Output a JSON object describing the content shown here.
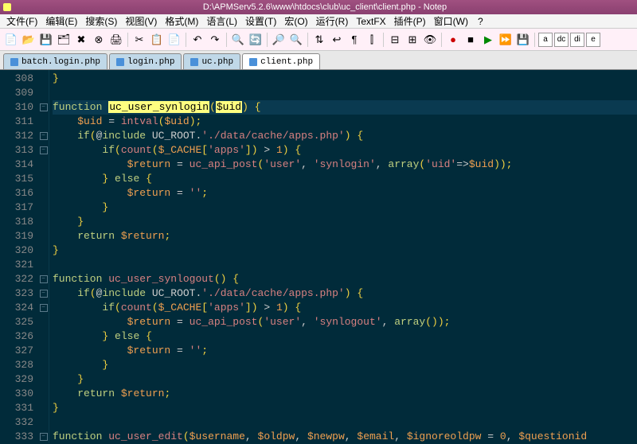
{
  "titlebar": {
    "title": "D:\\APMServ5.2.6\\www\\htdocs\\club\\uc_client\\client.php - Notep"
  },
  "menubar": {
    "items": [
      "文件(F)",
      "编辑(E)",
      "搜索(S)",
      "视图(V)",
      "格式(M)",
      "语言(L)",
      "设置(T)",
      "宏(O)",
      "运行(R)",
      "TextFX",
      "插件(P)",
      "窗口(W)",
      "?"
    ]
  },
  "toolbar": {
    "letters": [
      "a",
      "dc",
      "di",
      "e"
    ]
  },
  "tabs": {
    "items": [
      {
        "label": "batch.login.php",
        "active": false
      },
      {
        "label": "login.php",
        "active": false
      },
      {
        "label": "uc.php",
        "active": false
      },
      {
        "label": "client.php",
        "active": true
      }
    ]
  },
  "gutter": {
    "start": 308,
    "end": 333
  },
  "code": {
    "lines": [
      {
        "n": 308,
        "html": "<span class='pn'>}</span>"
      },
      {
        "n": 309,
        "html": ""
      },
      {
        "n": 310,
        "html": "<span class='kw'>function</span> <span class='fn-hl'>uc_user_synlogin</span><span class='pn'>(</span><span class='hl'>$uid</span><span class='pn'>)</span> <span class='pn'>{</span>",
        "cur": true,
        "fold": "-"
      },
      {
        "n": 311,
        "html": "    <span class='var'>$uid</span> <span class='op'>=</span> <span class='fn'>intval</span><span class='pn'>(</span><span class='var'>$uid</span><span class='pn'>);</span>"
      },
      {
        "n": 312,
        "html": "    <span class='kw'>if</span><span class='pn'>(</span><span class='op'>@</span><span class='kw'>include</span> <span class='const'>UC_ROOT</span><span class='op'>.</span><span class='str'>'./data/cache/apps.php'</span><span class='pn'>)</span> <span class='pn'>{</span>",
        "fold": "-"
      },
      {
        "n": 313,
        "html": "        <span class='kw'>if</span><span class='pn'>(</span><span class='fn'>count</span><span class='pn'>(</span><span class='var'>$_CACHE</span><span class='pn'>[</span><span class='str'>'apps'</span><span class='pn'>])</span> <span class='op'>&gt;</span> <span class='num'>1</span><span class='pn'>)</span> <span class='pn'>{</span>",
        "fold": "-"
      },
      {
        "n": 314,
        "html": "            <span class='var'>$return</span> <span class='op'>=</span> <span class='fn'>uc_api_post</span><span class='pn'>(</span><span class='str'>'user'</span><span class='op'>,</span> <span class='str'>'synlogin'</span><span class='op'>,</span> <span class='kw'>array</span><span class='pn'>(</span><span class='str'>'uid'</span><span class='op'>=&gt;</span><span class='var'>$uid</span><span class='pn'>));</span>"
      },
      {
        "n": 315,
        "html": "        <span class='pn'>}</span> <span class='kw'>else</span> <span class='pn'>{</span>"
      },
      {
        "n": 316,
        "html": "            <span class='var'>$return</span> <span class='op'>=</span> <span class='str'>''</span><span class='pn'>;</span>"
      },
      {
        "n": 317,
        "html": "        <span class='pn'>}</span>"
      },
      {
        "n": 318,
        "html": "    <span class='pn'>}</span>"
      },
      {
        "n": 319,
        "html": "    <span class='kw'>return</span> <span class='var'>$return</span><span class='pn'>;</span>"
      },
      {
        "n": 320,
        "html": "<span class='pn'>}</span>"
      },
      {
        "n": 321,
        "html": ""
      },
      {
        "n": 322,
        "html": "<span class='kw'>function</span> <span class='fn'>uc_user_synlogout</span><span class='pn'>()</span> <span class='pn'>{</span>",
        "fold": "-"
      },
      {
        "n": 323,
        "html": "    <span class='kw'>if</span><span class='pn'>(</span><span class='op'>@</span><span class='kw'>include</span> <span class='const'>UC_ROOT</span><span class='op'>.</span><span class='str'>'./data/cache/apps.php'</span><span class='pn'>)</span> <span class='pn'>{</span>",
        "fold": "-"
      },
      {
        "n": 324,
        "html": "        <span class='kw'>if</span><span class='pn'>(</span><span class='fn'>count</span><span class='pn'>(</span><span class='var'>$_CACHE</span><span class='pn'>[</span><span class='str'>'apps'</span><span class='pn'>])</span> <span class='op'>&gt;</span> <span class='num'>1</span><span class='pn'>)</span> <span class='pn'>{</span>",
        "fold": "-"
      },
      {
        "n": 325,
        "html": "            <span class='var'>$return</span> <span class='op'>=</span> <span class='fn'>uc_api_post</span><span class='pn'>(</span><span class='str'>'user'</span><span class='op'>,</span> <span class='str'>'synlogout'</span><span class='op'>,</span> <span class='kw'>array</span><span class='pn'>());</span>"
      },
      {
        "n": 326,
        "html": "        <span class='pn'>}</span> <span class='kw'>else</span> <span class='pn'>{</span>"
      },
      {
        "n": 327,
        "html": "            <span class='var'>$return</span> <span class='op'>=</span> <span class='str'>''</span><span class='pn'>;</span>"
      },
      {
        "n": 328,
        "html": "        <span class='pn'>}</span>"
      },
      {
        "n": 329,
        "html": "    <span class='pn'>}</span>"
      },
      {
        "n": 330,
        "html": "    <span class='kw'>return</span> <span class='var'>$return</span><span class='pn'>;</span>"
      },
      {
        "n": 331,
        "html": "<span class='pn'>}</span>"
      },
      {
        "n": 332,
        "html": ""
      },
      {
        "n": 333,
        "html": "<span class='kw'>function</span> <span class='fn'>uc_user_edit</span><span class='pn'>(</span><span class='var'>$username</span><span class='op'>,</span> <span class='var'>$oldpw</span><span class='op'>,</span> <span class='var'>$newpw</span><span class='op'>,</span> <span class='var'>$email</span><span class='op'>,</span> <span class='var'>$ignoreoldpw</span> <span class='op'>=</span> <span class='num'>0</span><span class='op'>,</span> <span class='var'>$questionid</span>",
        "fold": "-"
      }
    ]
  }
}
